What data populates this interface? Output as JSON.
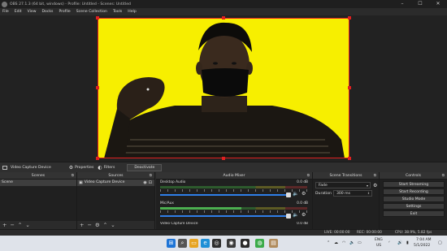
{
  "window": {
    "title": "OBS 27.1.3 (64 bit, windows) - Profile: Untitled - Scenes: Untitled",
    "controls": [
      "–",
      "☐",
      "✕"
    ]
  },
  "menu": [
    "File",
    "Edit",
    "View",
    "Docks",
    "Profile",
    "Scene Collection",
    "Tools",
    "Help"
  ],
  "context_bar": {
    "source_name": "Video Capture Device",
    "properties_label": "Properties",
    "filters_label": "Filters",
    "deactivate_label": "Deactivate"
  },
  "scenes": {
    "title": "Scenes",
    "items": [
      {
        "label": "Scene",
        "selected": true
      }
    ]
  },
  "sources": {
    "title": "Sources",
    "items": [
      {
        "label": "Video Capture Device",
        "visible_icon": "eye-icon",
        "lock_icon": "unlock-icon"
      }
    ]
  },
  "audio_mixer": {
    "title": "Audio Mixer",
    "channels": [
      {
        "name": "Desktop Audio",
        "db": "0.0 dB",
        "level": 0.0
      },
      {
        "name": "Mic/Aux",
        "db": "0.0 dB",
        "level": 0.55
      },
      {
        "name": "Video Capture Device",
        "db": "0.0 dB",
        "level": 0.0
      }
    ]
  },
  "transitions": {
    "title": "Scene Transitions",
    "transition": "Fade",
    "duration_label": "Duration",
    "duration": "300 ms"
  },
  "controls": {
    "title": "Controls",
    "buttons": [
      "Start Streaming",
      "Start Recording",
      "Studio Mode",
      "Settings",
      "Exit"
    ]
  },
  "status": {
    "live": "LIVE: 00:00:00",
    "rec": "REC: 00:00:00",
    "cpu": "CPU: 38.9%, 5.82 fps"
  },
  "taskbar": {
    "lang_top": "ENG",
    "lang_bottom": "US",
    "time": "7:04 AM",
    "date": "5/1/2022"
  },
  "colors": {
    "canvas_background": "#f7ef00",
    "selection": "#e02020",
    "fader": "#2f7ee8",
    "meter_level": "#4caf50"
  }
}
